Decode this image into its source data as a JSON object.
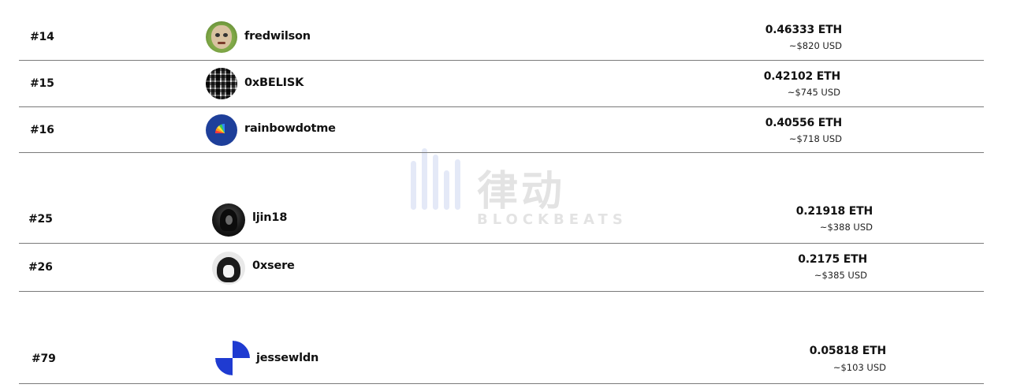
{
  "leaderboard": {
    "rows": [
      {
        "rank": "#14",
        "username": "fredwilson",
        "eth": "0.46333 ETH",
        "usd": "~$820 USD",
        "avatar_icon": "cartoon-face-avatar-icon"
      },
      {
        "rank": "#15",
        "username": "0xBELISK",
        "eth": "0.42102 ETH",
        "usd": "~$745 USD",
        "avatar_icon": "grid-pattern-avatar-icon"
      },
      {
        "rank": "#16",
        "username": "rainbowdotme",
        "eth": "0.40556 ETH",
        "usd": "~$718 USD",
        "avatar_icon": "rainbow-avatar-icon"
      },
      {
        "rank": "#25",
        "username": "ljin18",
        "eth": "0.21918 ETH",
        "usd": "~$388 USD",
        "avatar_icon": "portrait-avatar-icon"
      },
      {
        "rank": "#26",
        "username": "0xsere",
        "eth": "0.2175 ETH",
        "usd": "~$385 USD",
        "avatar_icon": "anime-avatar-icon"
      },
      {
        "rank": "#79",
        "username": "jessewldn",
        "eth": "0.05818 ETH",
        "usd": "~$103 USD",
        "avatar_icon": "blue-quadrant-avatar-icon"
      }
    ]
  },
  "watermark": {
    "title": "律动",
    "subtitle": "BLOCKBEATS",
    "color": "#2a56c6"
  }
}
